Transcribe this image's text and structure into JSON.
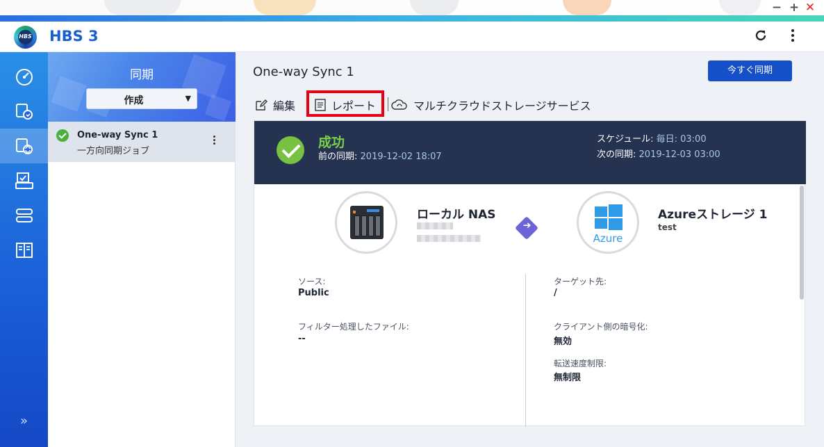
{
  "window": {
    "minimize": "−",
    "maximize": "+",
    "close": "✕"
  },
  "header": {
    "app_title": "HBS 3",
    "logo_text": "HBS"
  },
  "rail": {
    "items": [
      {
        "name": "dashboard-icon"
      },
      {
        "name": "backup-restore-icon"
      },
      {
        "name": "sync-icon",
        "active": true
      },
      {
        "name": "jobs-icon"
      },
      {
        "name": "storage-icon"
      },
      {
        "name": "services-icon"
      }
    ],
    "expand_label": "»"
  },
  "side": {
    "title": "同期",
    "create_label": "作成",
    "jobs": [
      {
        "name": "One-way Sync 1",
        "type": "一方向同期ジョブ"
      }
    ]
  },
  "main": {
    "job_title": "One-way Sync 1",
    "sync_now_label": "今すぐ同期",
    "toolbar": {
      "edit_label": "編集",
      "report_label": "レポート",
      "multicloud_label": "マルチクラウドストレージサービス"
    },
    "status": {
      "result": "成功",
      "last_sync_label": "前の同期:",
      "last_sync_value": "2019-12-02 18:07",
      "schedule_label": "スケジュール:",
      "schedule_value": "毎日: 03:00",
      "next_sync_label": "次の同期:",
      "next_sync_value": "2019-12-03 03:00"
    },
    "source_node": {
      "title": "ローカル NAS"
    },
    "target_node": {
      "title": "Azureストレージ 1",
      "subtitle": "test",
      "logo_text": "Azure"
    },
    "details_left": [
      {
        "label": "ソース:",
        "value": "Public"
      },
      {
        "label": "フィルター処理したファイル:",
        "value": "--"
      }
    ],
    "details_right": [
      {
        "label": "ターゲット先:",
        "value": "/"
      },
      {
        "label": "クライアント側の暗号化:",
        "value": "無効"
      },
      {
        "label": "転送速度制限:",
        "value": "無制限"
      }
    ]
  },
  "colors": {
    "accent": "#1550c9",
    "success": "#78c142",
    "status_band": "#253351",
    "highlight_box": "#e60012"
  }
}
